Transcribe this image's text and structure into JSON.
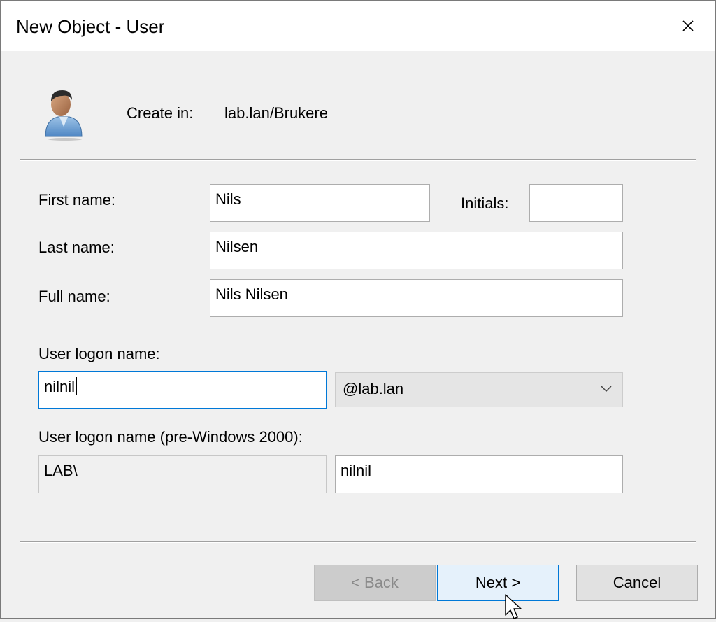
{
  "window": {
    "title": "New Object - User"
  },
  "header": {
    "create_in_label": "Create in:",
    "create_in_value": "lab.lan/Brukere"
  },
  "form": {
    "first_name_label": "First name:",
    "first_name_value": "Nils",
    "initials_label": "Initials:",
    "initials_value": "",
    "last_name_label": "Last name:",
    "last_name_value": "Nilsen",
    "full_name_label": "Full name:",
    "full_name_value": "Nils Nilsen",
    "logon_name_label": "User logon name:",
    "logon_name_value": "nilnil",
    "domain_suffix_value": "@lab.lan",
    "pre2000_label": "User logon name (pre-Windows 2000):",
    "pre2000_domain_value": "LAB\\",
    "pre2000_user_value": "nilnil"
  },
  "buttons": {
    "back_label": "< Back",
    "next_label": "Next >",
    "cancel_label": "Cancel"
  },
  "colors": {
    "focus_accent": "#0078d7",
    "default_button_bg": "#e5f1fb"
  }
}
